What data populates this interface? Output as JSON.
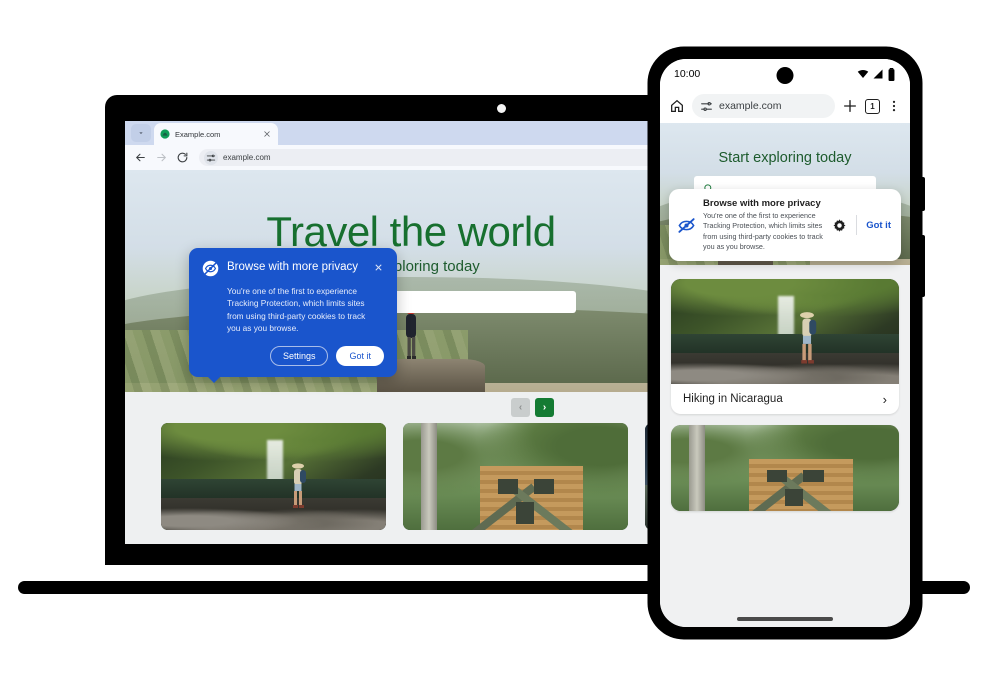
{
  "scene": {
    "description": "Chrome Tracking Protection onboarding dialog shown on a laptop and an Android phone",
    "accent_blue": "#1a55cc",
    "brand_green": "#17702f",
    "carousel_green": "#147b33"
  },
  "desktop": {
    "tab": {
      "title": "Example.com",
      "favicon_name": "example-site-favicon",
      "close_label": "×",
      "tab_search_label": "⌄"
    },
    "toolbar": {
      "back_label": "←",
      "forward_label": "→",
      "reload_label": "⟳",
      "tune_icon_name": "tracking-protection-tune-icon",
      "url": "example.com"
    },
    "page": {
      "hero_title": "Travel the world",
      "hero_subtitle": "Start exploring today",
      "search_placeholder": "",
      "search_icon_name": "search-icon",
      "carousel": {
        "prev_label": "‹",
        "next_label": "›"
      },
      "cards": [
        {
          "caption": "",
          "photo": "waterfall-hiker"
        },
        {
          "caption": "",
          "photo": "log-cabin"
        },
        {
          "caption": "",
          "photo": "night-road"
        }
      ]
    },
    "dialog": {
      "icon_name": "tracking-protection-eye-off-icon",
      "title": "Browse with more privacy",
      "body": "You're one of the first to experience Tracking Protection, which limits sites from using third-party cookies to track you as you browse.",
      "close_label": "×",
      "settings_label": "Settings",
      "got_it_label": "Got it"
    }
  },
  "phone": {
    "status_bar": {
      "time": "10:00",
      "wifi_icon_name": "wifi-icon",
      "signal_icon_name": "cellular-signal-icon",
      "battery_icon_name": "battery-icon"
    },
    "toolbar": {
      "home_icon_name": "home-icon",
      "tune_icon_name": "tracking-protection-tune-icon",
      "url": "example.com",
      "new_tab_label": "+",
      "tab_count": "1",
      "menu_label": "⋮"
    },
    "page": {
      "hero_subtitle": "Start exploring today",
      "search_icon_name": "search-icon",
      "cards": [
        {
          "title": "Hiking in Nicaragua",
          "chevron": "›",
          "photo": "waterfall-hiker"
        },
        {
          "title": "",
          "chevron": "",
          "photo": "log-cabin"
        }
      ]
    },
    "dialog": {
      "icon_name": "tracking-protection-eye-off-icon",
      "title": "Browse with more privacy",
      "body": "You're one of the first to experience Tracking Protection, which limits sites from using third-party cookies to track you as you browse.",
      "settings_icon_name": "gear-icon",
      "got_it_label": "Got it"
    }
  }
}
